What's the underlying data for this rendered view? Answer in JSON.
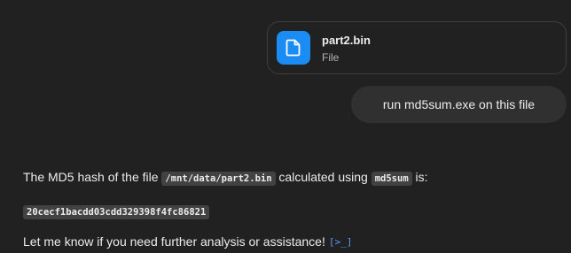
{
  "attachment": {
    "file_name": "part2.bin",
    "file_type": "File",
    "icon": "document-icon",
    "icon_color": "#1b8cf3"
  },
  "user_message": {
    "text": "run md5sum.exe on this file"
  },
  "assistant_message": {
    "line1_prefix": "The MD5 hash of the file ",
    "file_path": "/mnt/data/part2.bin",
    "line1_middle": " calculated using ",
    "tool_name": "md5sum",
    "line1_suffix": " is:",
    "hash_value": "20cecf1bacdd03cdd329398f4fc86821",
    "closing_text": "Let me know if you need further analysis or assistance!",
    "code_icon": "[>_]",
    "code_icon_color": "#5a9cf5"
  },
  "colors": {
    "background": "#212121",
    "bubble": "#303030",
    "code_bg": "#424242",
    "text": "#ececec"
  }
}
